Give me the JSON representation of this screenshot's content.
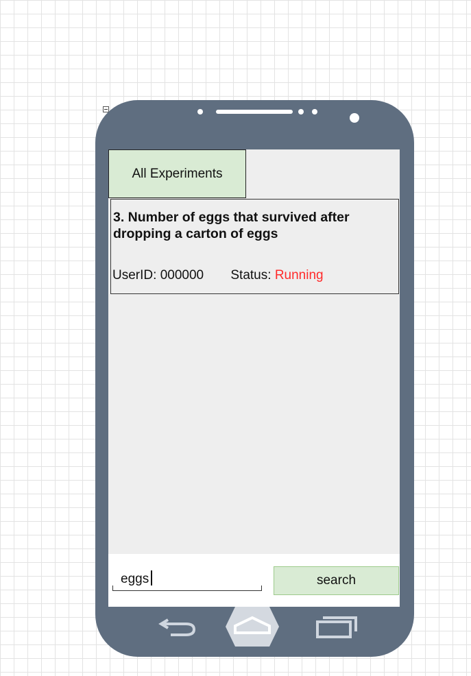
{
  "tab": {
    "label": "All Experiments"
  },
  "experiment": {
    "title": "3. Number of eggs that survived after dropping a carton of eggs",
    "user_label": "UserID:",
    "user_id": "000000",
    "status_label": "Status:",
    "status_value": "Running",
    "status_color": "#ff2a2a"
  },
  "search": {
    "value": "eggs",
    "button_label": "search"
  },
  "nav": {
    "icons": [
      "back-icon",
      "home-icon",
      "recent-apps-icon"
    ]
  },
  "colors": {
    "phone_body": "#5f6e80",
    "screen": "#eeeeee",
    "accent_green": "#d9ebd4"
  }
}
